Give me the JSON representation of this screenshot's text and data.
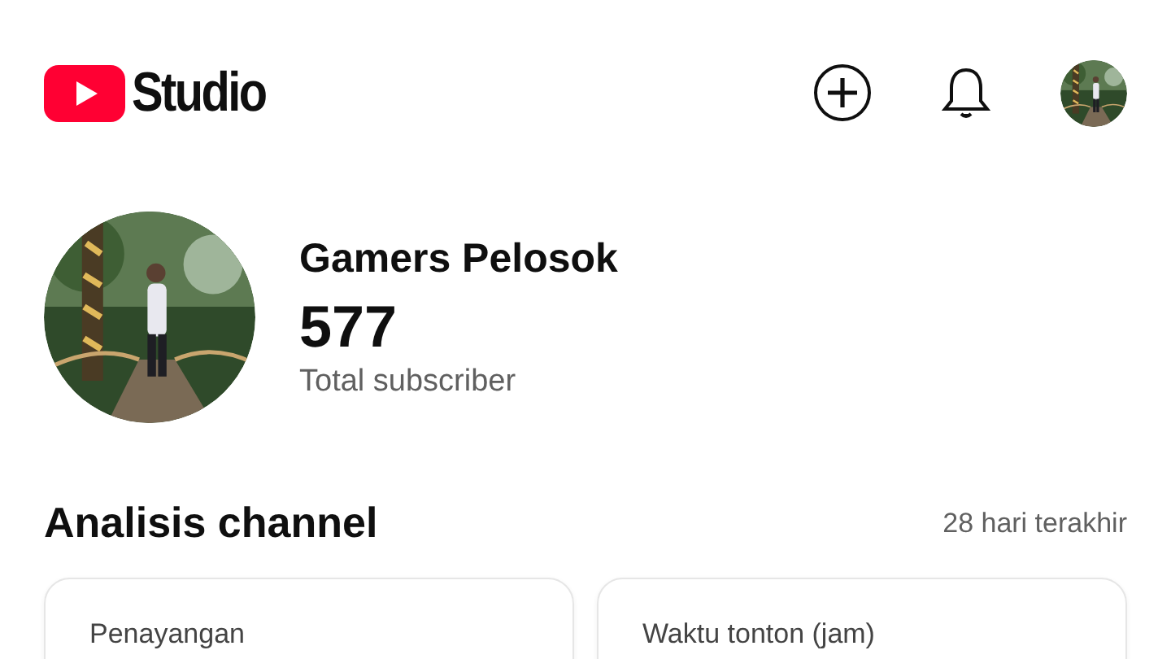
{
  "header": {
    "logo_text": "Studio"
  },
  "channel": {
    "name": "Gamers Pelosok",
    "subscribers": "577",
    "subscribers_label": "Total subscriber"
  },
  "analytics": {
    "title": "Analisis channel",
    "period": "28 hari terakhir",
    "cards": [
      {
        "label": "Penayangan"
      },
      {
        "label": "Waktu tonton (jam)"
      }
    ]
  }
}
